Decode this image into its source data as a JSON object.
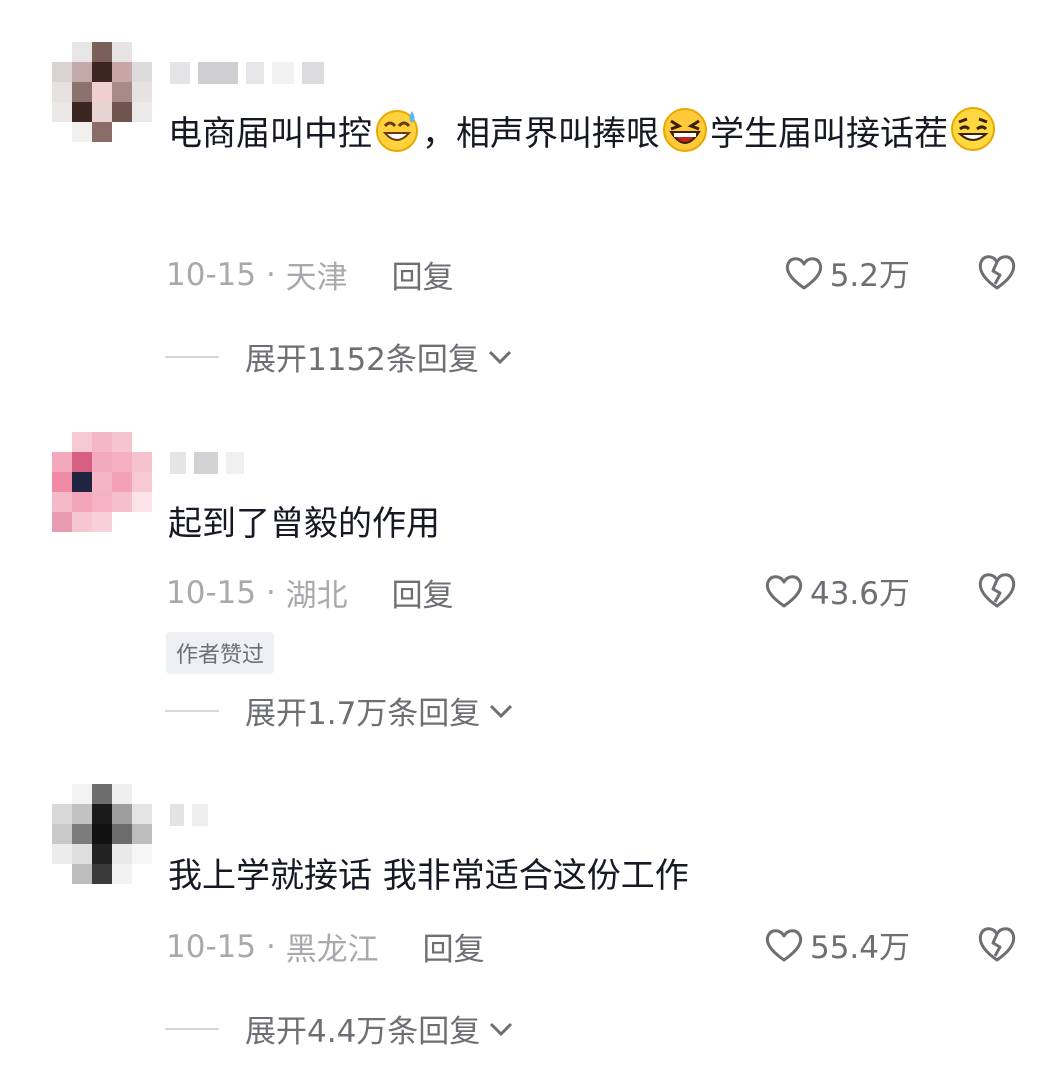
{
  "comments": [
    {
      "text_parts": [
        "电商届叫中控",
        "，相声界叫捧哏",
        "学生届叫接话茬"
      ],
      "emojis": [
        "sweat-smile-emoji",
        "laughing-emoji",
        "grinning-emoji"
      ],
      "date": "10-15",
      "location": "天津",
      "reply_label": "回复",
      "likes": "5.2万",
      "expand_label": "展开1152条回复"
    },
    {
      "text": "起到了曾毅的作用",
      "date": "10-15",
      "location": "湖北",
      "reply_label": "回复",
      "likes": "43.6万",
      "badge": "作者赞过",
      "expand_label": "展开1.7万条回复"
    },
    {
      "text": "我上学就接话 我非常适合这份工作",
      "date": "10-15",
      "location": "黑龙江",
      "reply_label": "回复",
      "likes": "55.4万",
      "expand_label": "展开4.4万条回复"
    }
  ],
  "separator": " · ",
  "colors": {
    "meta": "#a8a9ad",
    "action": "#6e6f74",
    "text": "#161823"
  }
}
